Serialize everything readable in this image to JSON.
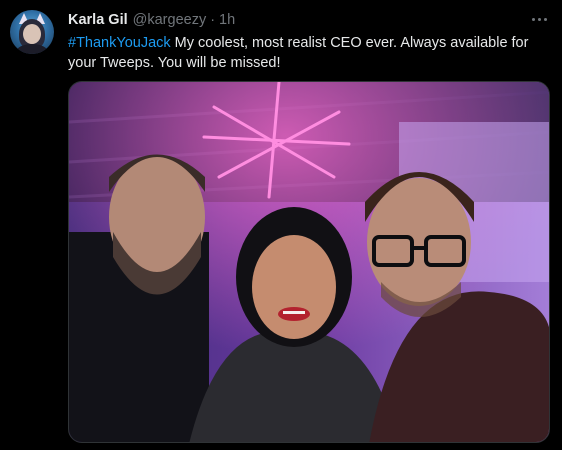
{
  "tweet": {
    "author_name": "Karla Gil",
    "handle": "@kargeezy",
    "separator": "·",
    "time": "1h",
    "hashtag": "#ThankYouJack",
    "body": " My coolest, most realist CEO ever. Always available for your Tweeps. You will be missed!"
  },
  "colors": {
    "background": "#000000",
    "text": "#e7e9ea",
    "muted": "#71767b",
    "link": "#1d9bf0"
  },
  "icons": {
    "more": "more-horizontal-icon"
  }
}
